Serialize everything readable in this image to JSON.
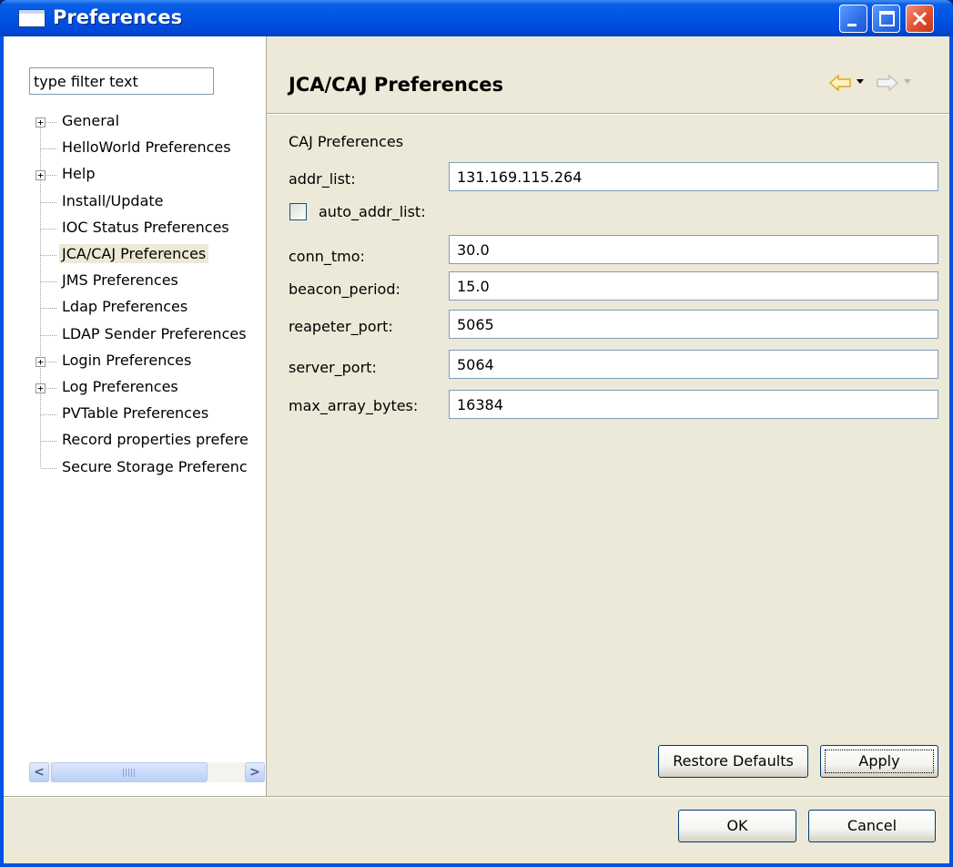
{
  "window": {
    "title": "Preferences",
    "controls": [
      "minimize",
      "maximize",
      "close"
    ]
  },
  "sidebar": {
    "filter_placeholder": "type filter text",
    "items": [
      {
        "label": "General",
        "expandable": true
      },
      {
        "label": "HelloWorld Preferences",
        "expandable": false
      },
      {
        "label": "Help",
        "expandable": true
      },
      {
        "label": "Install/Update",
        "expandable": false
      },
      {
        "label": "IOC Status Preferences",
        "expandable": false
      },
      {
        "label": "JCA/CAJ Preferences",
        "expandable": false,
        "selected": true
      },
      {
        "label": "JMS Preferences",
        "expandable": false
      },
      {
        "label": "Ldap Preferences",
        "expandable": false
      },
      {
        "label": "LDAP Sender Preferences",
        "expandable": false
      },
      {
        "label": "Login Preferences",
        "expandable": true
      },
      {
        "label": "Log Preferences",
        "expandable": true
      },
      {
        "label": "PVTable Preferences",
        "expandable": false
      },
      {
        "label": "Record properties prefere",
        "expandable": false
      },
      {
        "label": "Secure Storage Preferenc",
        "expandable": false
      }
    ],
    "expander_glyph": "+",
    "scroll_left_glyph": "<",
    "scroll_right_glyph": ">"
  },
  "page": {
    "title": "JCA/CAJ Preferences",
    "group_label": "CAJ Preferences",
    "fields": {
      "addr_list": {
        "label": "addr_list:",
        "value": "131.169.115.264"
      },
      "auto_addr_list": {
        "label": "auto_addr_list:",
        "checked": false
      },
      "conn_tmo": {
        "label": "conn_tmo:",
        "value": "30.0"
      },
      "beacon_period": {
        "label": "beacon_period:",
        "value": "15.0"
      },
      "reapeter_port": {
        "label": "reapeter_port:",
        "value": "5065"
      },
      "server_port": {
        "label": "server_port:",
        "value": "5064"
      },
      "max_array_bytes": {
        "label": "max_array_bytes:",
        "value": "16384"
      }
    },
    "restore_defaults_label": "Restore Defaults",
    "apply_label": "Apply"
  },
  "footer": {
    "ok_label": "OK",
    "cancel_label": "Cancel"
  },
  "colors": {
    "titlebar": "#0055e5",
    "dialog_bg": "#ece9d8",
    "nav_back_arrow": "#f2c94c"
  }
}
